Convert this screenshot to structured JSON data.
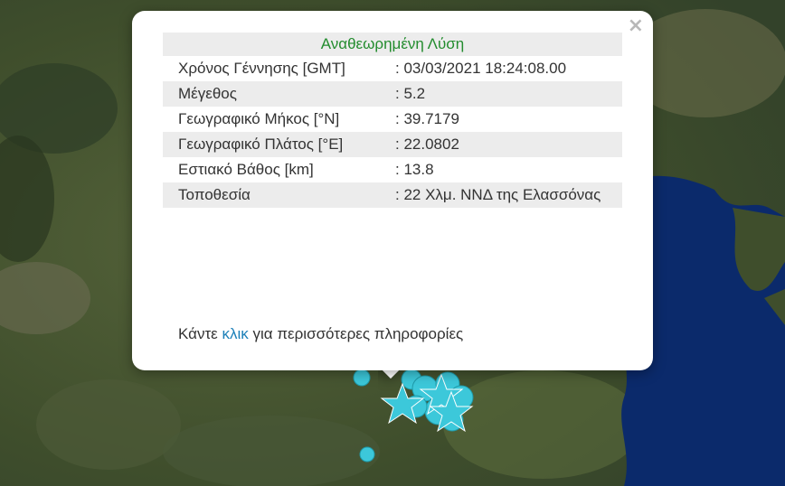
{
  "popup": {
    "title": "Αναθεωρημένη Λύση",
    "close_label": "×",
    "rows": [
      {
        "label": "Χρόνος Γέννησης [GMT]",
        "value": ": 03/03/2021 18:24:08.00"
      },
      {
        "label": "Μέγεθος",
        "value": ": 5.2"
      },
      {
        "label": "Γεωγραφικό Μήκος [°N]",
        "value": ": 39.7179"
      },
      {
        "label": "Γεωγραφικό Πλάτος [°E]",
        "value": ": 22.0802"
      },
      {
        "label": "Εστιακό Βάθος [km]",
        "value": ": 13.8"
      },
      {
        "label": "Τοποθεσία",
        "value": ": 22 Χλμ. ΝΝΔ της Ελασσόνας"
      }
    ],
    "footer_pre": "Κάντε ",
    "footer_link": "κλικ",
    "footer_post": " για περισσότερες πληροφορίες"
  },
  "colors": {
    "title_green": "#238c2e",
    "link_blue": "#1a7fb8",
    "marker_cyan": "#3cc8da",
    "sea_blue": "#0b2a6b"
  }
}
